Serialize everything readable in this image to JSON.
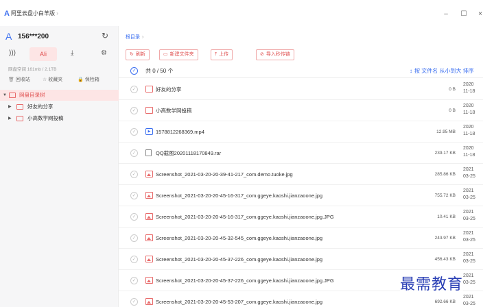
{
  "app": {
    "title": "阿里云盘小白羊版",
    "title_suffix": "›",
    "logo": "A",
    "accent_color": "#3a6ef0",
    "brand_red": "#e05252"
  },
  "window_controls": {
    "minimize": "–",
    "maximize": "☐",
    "close": "×"
  },
  "sidebar": {
    "account_name": "156***200",
    "tabs": {
      "ali_label": "Ali"
    },
    "space_text": "网盘空间 161mb / 2.1TB",
    "quick_links": [
      {
        "label": "回收站",
        "icon": "trash-icon",
        "glyph": "🗑"
      },
      {
        "label": "收藏夹",
        "icon": "star-icon",
        "glyph": "☆"
      },
      {
        "label": "保险箱",
        "icon": "lock-icon",
        "glyph": "🔒"
      }
    ],
    "tree": {
      "root": "网盘目录树",
      "children": [
        "好友的分享",
        "小高数学网投稿"
      ]
    }
  },
  "main": {
    "breadcrumb": "根目录",
    "breadcrumb_sep": "›",
    "toolbar": {
      "refresh": "刷新",
      "new_folder": "新建文件夹",
      "upload": "上传",
      "import_link": "导入秒传链"
    },
    "header": {
      "count": "共 0 / 50 个",
      "sort_label": "按 文件名 从小到大 排序"
    },
    "files": [
      {
        "name": "好友的分享",
        "type": "folder",
        "size": "0 B",
        "date_year": "2020",
        "date_md": "11-18"
      },
      {
        "name": "小高数学网投稿",
        "type": "folder",
        "size": "0 B",
        "date_year": "2020",
        "date_md": "11-18"
      },
      {
        "name": "1578812268369.mp4",
        "type": "video",
        "size": "12.95 MB",
        "date_year": "2020",
        "date_md": "11-18"
      },
      {
        "name": "QQ截图20201118170849.rar",
        "type": "rar",
        "size": "239.17 KB",
        "date_year": "2020",
        "date_md": "11-18"
      },
      {
        "name": "Screenshot_2021-03-20-20-39-41-217_com.demo.tuoke.jpg",
        "type": "image",
        "size": "285.86 KB",
        "date_year": "2021",
        "date_md": "03-25"
      },
      {
        "name": "Screenshot_2021-03-20-20-45-16-317_com.ggeye.kaoshi.jianzaoone.jpg",
        "type": "image",
        "size": "755.72 KB",
        "date_year": "2021",
        "date_md": "03-25"
      },
      {
        "name": "Screenshot_2021-03-20-20-45-16-317_com.ggeye.kaoshi.jianzaoone.jpg.JPG",
        "type": "image",
        "size": "10.41 KB",
        "date_year": "2021",
        "date_md": "03-25"
      },
      {
        "name": "Screenshot_2021-03-20-20-45-32-545_com.ggeye.kaoshi.jianzaoone.jpg",
        "type": "image",
        "size": "243.97 KB",
        "date_year": "2021",
        "date_md": "03-25"
      },
      {
        "name": "Screenshot_2021-03-20-20-45-37-226_com.ggeye.kaoshi.jianzaoone.jpg",
        "type": "image",
        "size": "456.43 KB",
        "date_year": "2021",
        "date_md": "03-25"
      },
      {
        "name": "Screenshot_2021-03-20-20-45-37-226_com.ggeye.kaoshi.jianzaoone.jpg.JPG",
        "type": "image",
        "size": "",
        "date_year": "2021",
        "date_md": "03-25"
      },
      {
        "name": "Screenshot_2021-03-20-20-45-53-207_com.ggeye.kaoshi.jianzaoone.jpg",
        "type": "image",
        "size": "692.66 KB",
        "date_year": "2021",
        "date_md": "03-25"
      }
    ]
  },
  "watermark": "最需教育"
}
